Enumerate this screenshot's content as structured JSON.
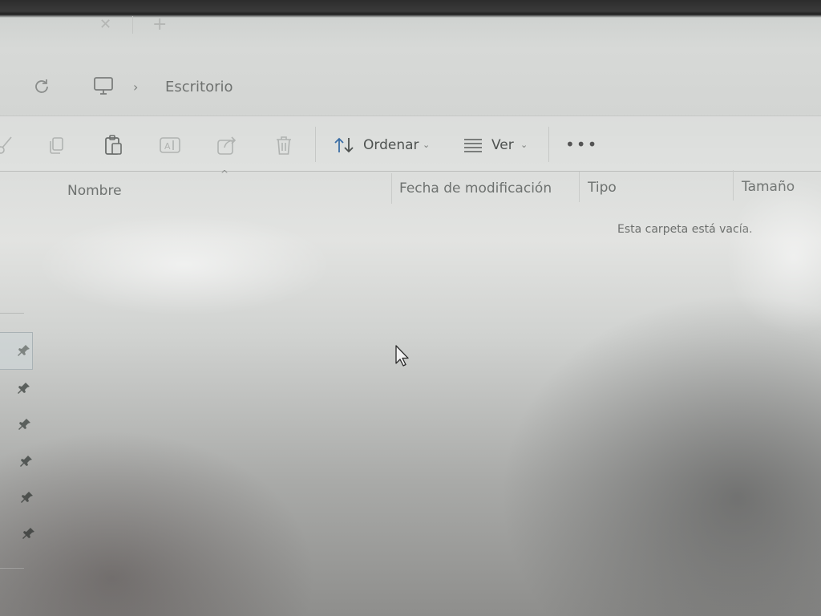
{
  "tab": {
    "close_icon": "close-icon",
    "add_icon": "plus-icon"
  },
  "address": {
    "location_icon": "computer-icon",
    "current_folder": "Escritorio",
    "separator": "›"
  },
  "toolbar": {
    "icons": [
      "cut-icon",
      "copy-icon",
      "paste-icon",
      "rename-icon",
      "share-icon",
      "delete-icon"
    ],
    "sort_label": "Ordenar",
    "view_label": "Ver",
    "more_label": "•••"
  },
  "columns": {
    "name": "Nombre",
    "modified": "Fecha de modificación",
    "type": "Tipo",
    "size": "Tamaño"
  },
  "content": {
    "empty_message": "Esta carpeta está vacía."
  },
  "sidebar": {
    "pinned_items": [
      "pin-icon",
      "pin-icon",
      "pin-icon",
      "pin-icon",
      "pin-icon",
      "pin-icon"
    ]
  },
  "colors": {
    "accent": "#3b6ea5",
    "text": "#4e5250",
    "muted_text": "#6e7270"
  }
}
